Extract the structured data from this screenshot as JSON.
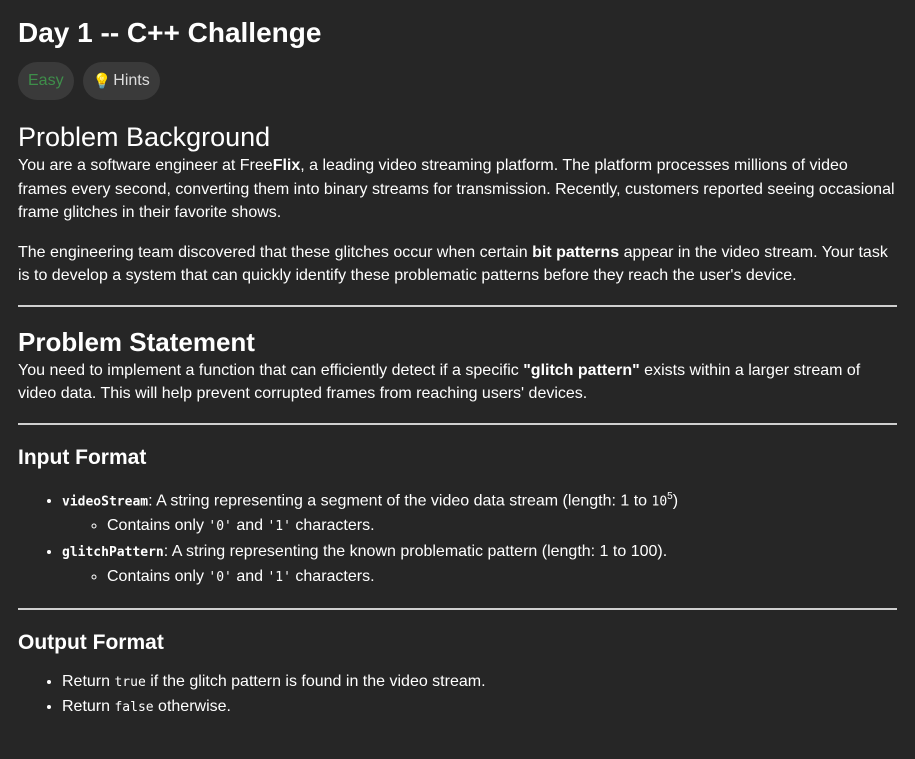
{
  "title": "Day 1 -- C++ Challenge",
  "badges": {
    "difficulty": "Easy",
    "hints": "Hints",
    "hints_icon": "lightbulb-icon",
    "difficulty_color": "#3e8e4a"
  },
  "background": {
    "heading": "Problem Background",
    "p1_a": "You are a software engineer at Free",
    "p1_b": "Flix",
    "p1_c": ", a leading video streaming platform. The platform processes millions of video frames every second, converting them into binary streams for transmission. Recently, customers reported seeing occasional frame glitches in their favorite shows.",
    "p2_a": "The engineering team discovered that these glitches occur when certain ",
    "p2_b": "bit patterns",
    "p2_c": " appear in the video stream. Your task is to develop a system that can quickly identify these problematic patterns before they reach the user's device."
  },
  "statement": {
    "heading": "Problem Statement",
    "p_a": "You need to implement a function that can efficiently detect if a specific ",
    "p_b": "\"glitch pattern\"",
    "p_c": " exists within a larger stream of video data. This will help prevent corrupted frames from reaching users' devices."
  },
  "input": {
    "heading": "Input Format",
    "i1_code": "videoStream",
    "i1_text": ": A string representing a segment of the video data stream (length: 1 to ",
    "i1_pow_base": "10",
    "i1_pow_exp": "5",
    "i1_end": ")",
    "i1_sub_a": "Contains only ",
    "zero": "'0'",
    "and": " and ",
    "one": "'1'",
    "sub_end": " characters.",
    "i2_code": "glitchPattern",
    "i2_text": ": A string representing the known problematic pattern (length: 1 to 100)."
  },
  "output": {
    "heading": "Output Format",
    "o1_a": "Return ",
    "o1_code": "true",
    "o1_b": " if the glitch pattern is found in the video stream.",
    "o2_a": "Return ",
    "o2_code": "false",
    "o2_b": " otherwise."
  }
}
